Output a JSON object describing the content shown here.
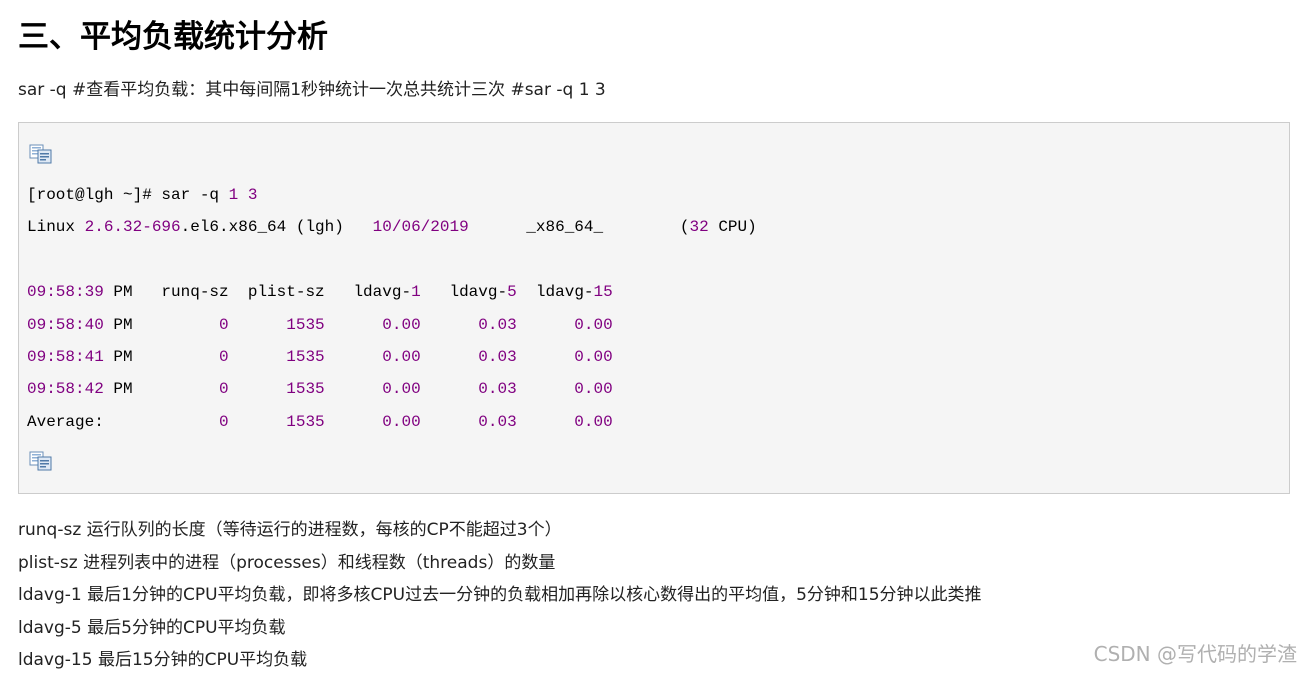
{
  "section": {
    "title": "三、平均负载统计分析"
  },
  "intro": {
    "text": "sar -q #查看平均负载：其中每间隔1秒钟统计一次总共统计三次  #sar -q 1 3"
  },
  "code": {
    "copy_icon": "copy-icon",
    "lines": [
      [
        {
          "t": "[root@lgh ~]# sar -q "
        },
        {
          "t": "1",
          "n": 1
        },
        {
          "t": " "
        },
        {
          "t": "3",
          "n": 1
        }
      ],
      [
        {
          "t": "Linux "
        },
        {
          "t": "2.6.32-696",
          "n": 1
        },
        {
          "t": ".el6.x86_64 (lgh)   "
        },
        {
          "t": "10/06/2019",
          "n": 1
        },
        {
          "t": "      _x86_64_        ("
        },
        {
          "t": "32",
          "n": 1
        },
        {
          "t": " CPU)"
        }
      ],
      [
        {
          "t": " "
        }
      ],
      [
        {
          "t": "09:58:39",
          "n": 1
        },
        {
          "t": " PM   runq-sz  plist-sz   ldavg-"
        },
        {
          "t": "1",
          "n": 1
        },
        {
          "t": "   ldavg-"
        },
        {
          "t": "5",
          "n": 1
        },
        {
          "t": "  ldavg-"
        },
        {
          "t": "15",
          "n": 1
        }
      ],
      [
        {
          "t": "09:58:40",
          "n": 1
        },
        {
          "t": " PM         "
        },
        {
          "t": "0",
          "n": 1
        },
        {
          "t": "      "
        },
        {
          "t": "1535",
          "n": 1
        },
        {
          "t": "      "
        },
        {
          "t": "0.00",
          "n": 1
        },
        {
          "t": "      "
        },
        {
          "t": "0.03",
          "n": 1
        },
        {
          "t": "      "
        },
        {
          "t": "0.00",
          "n": 1
        }
      ],
      [
        {
          "t": "09:58:41",
          "n": 1
        },
        {
          "t": " PM         "
        },
        {
          "t": "0",
          "n": 1
        },
        {
          "t": "      "
        },
        {
          "t": "1535",
          "n": 1
        },
        {
          "t": "      "
        },
        {
          "t": "0.00",
          "n": 1
        },
        {
          "t": "      "
        },
        {
          "t": "0.03",
          "n": 1
        },
        {
          "t": "      "
        },
        {
          "t": "0.00",
          "n": 1
        }
      ],
      [
        {
          "t": "09:58:42",
          "n": 1
        },
        {
          "t": " PM         "
        },
        {
          "t": "0",
          "n": 1
        },
        {
          "t": "      "
        },
        {
          "t": "1535",
          "n": 1
        },
        {
          "t": "      "
        },
        {
          "t": "0.00",
          "n": 1
        },
        {
          "t": "      "
        },
        {
          "t": "0.03",
          "n": 1
        },
        {
          "t": "      "
        },
        {
          "t": "0.00",
          "n": 1
        }
      ],
      [
        {
          "t": "Average:            "
        },
        {
          "t": "0",
          "n": 1
        },
        {
          "t": "      "
        },
        {
          "t": "1535",
          "n": 1
        },
        {
          "t": "      "
        },
        {
          "t": "0.00",
          "n": 1
        },
        {
          "t": "      "
        },
        {
          "t": "0.03",
          "n": 1
        },
        {
          "t": "      "
        },
        {
          "t": "0.00",
          "n": 1
        }
      ]
    ]
  },
  "descriptions": [
    {
      "term": "runq-sz",
      "text": " 运行队列的长度（等待运行的进程数，每核的CP不能超过3个）"
    },
    {
      "term": "plist-sz",
      "text": " 进程列表中的进程（processes）和线程数（threads）的数量"
    },
    {
      "term": "ldavg-1",
      "text": " 最后1分钟的CPU平均负载，即将多核CPU过去一分钟的负载相加再除以核心数得出的平均值，5分钟和15分钟以此类推"
    },
    {
      "term": "ldavg-5",
      "text": " 最后5分钟的CPU平均负载"
    },
    {
      "term": "ldavg-15",
      "text": " 最后15分钟的CPU平均负载"
    }
  ],
  "watermark": {
    "text": "CSDN @写代码的学渣"
  },
  "colors": {
    "number": "#800080",
    "code_background": "#f5f5f5",
    "code_border": "#cccccc"
  }
}
